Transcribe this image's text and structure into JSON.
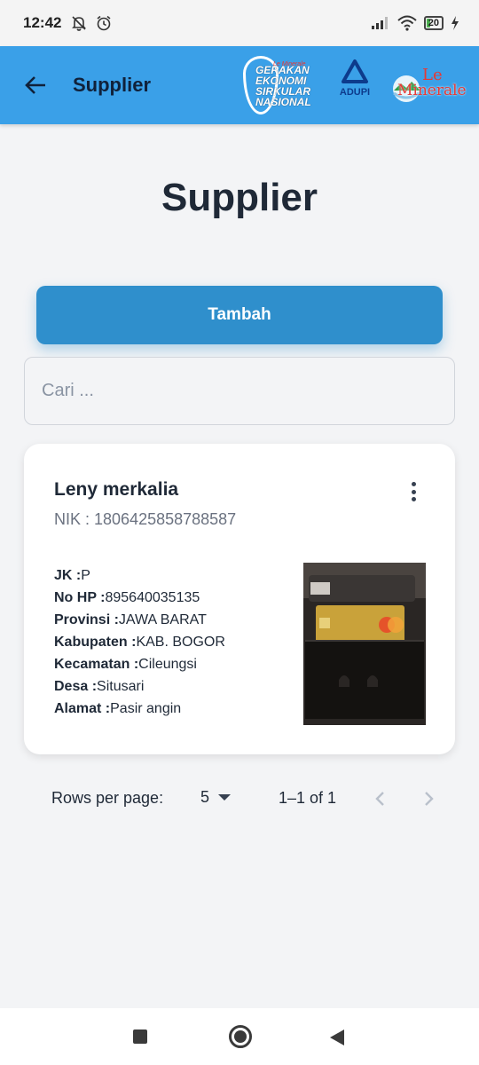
{
  "status_bar": {
    "time": "12:42",
    "battery": "20",
    "icons": [
      "notifications-off-icon",
      "alarm-icon",
      "signal-icon",
      "wifi-icon",
      "battery-icon",
      "charging-icon"
    ]
  },
  "app_bar": {
    "title": "Supplier",
    "back_icon": "arrow-left-icon",
    "background": "#3aa0e8",
    "logos": {
      "gerakan_small": "Le Minerale",
      "gerakan_lines": [
        "GERAKAN",
        "EKONOMI",
        "SIRKULAR",
        "NASIONAL"
      ],
      "adupi": "ADUPI",
      "lemin_le": "Le",
      "lemin_minerale": "Minerale"
    }
  },
  "page": {
    "heading": "Supplier",
    "add_button": "Tambah",
    "search_placeholder": "Cari ..."
  },
  "accent": "#2f8fcc",
  "suppliers": [
    {
      "name": "Leny merkalia",
      "nik": "NIK : 1806425858788587",
      "fields": [
        {
          "label": "JK :",
          "value": "P"
        },
        {
          "label": "No HP :",
          "value": "895640035135"
        },
        {
          "label": "Provinsi :",
          "value": "JAWA BARAT"
        },
        {
          "label": "Kabupaten :",
          "value": "KAB. BOGOR"
        },
        {
          "label": "Kecamatan :",
          "value": "Cileungsi"
        },
        {
          "label": "Desa :",
          "value": "Situsari"
        },
        {
          "label": "Alamat :",
          "value": "Pasir angin"
        }
      ],
      "photo_icon": "wallet-card-photo"
    }
  ],
  "pagination": {
    "rows_label": "Rows per page:",
    "rows_value": "5",
    "range": "1–1 of 1"
  },
  "nav_bar": {
    "icons": [
      "recent-apps-icon",
      "home-icon",
      "back-icon"
    ]
  }
}
